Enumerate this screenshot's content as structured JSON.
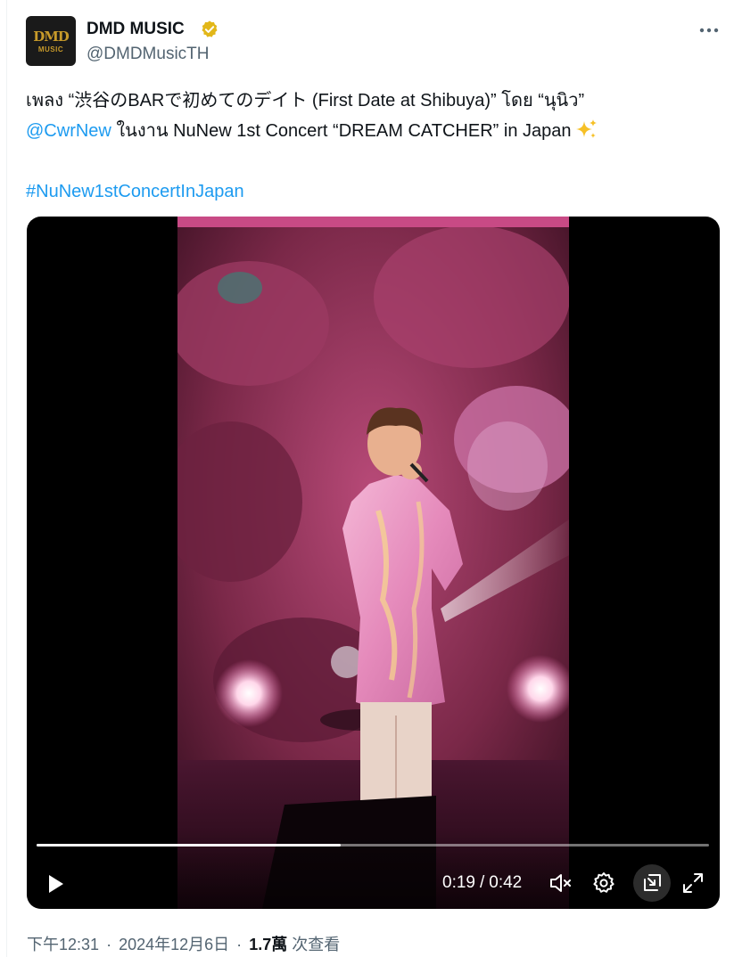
{
  "author": {
    "display_name": "DMD MUSIC",
    "handle": "@DMDMusicTH",
    "avatar_text_top": "DMD",
    "avatar_text_bottom": "MUSIC",
    "verified_color": "#e2b719"
  },
  "tweet": {
    "line1": "เพลง “渋谷のBARで初めてのデイト (First Date at Shibuya)” โดย “นุนิว”",
    "mention": "@CwrNew",
    "line2_rest": " ในงาน NuNew 1st Concert “DREAM CATCHER” in Japan",
    "sparkle_icon": "sparkles-icon",
    "hashtag": "#NuNew1stConcertInJapan"
  },
  "video": {
    "current_time": "0:19",
    "time_separator": "/",
    "duration": "0:42",
    "progress": 0.452
  },
  "meta": {
    "time": "下午12:31",
    "date": "2024年12月6日",
    "separator": "·",
    "views_count": "1.7萬",
    "views_label": "次查看"
  },
  "colors": {
    "link": "#1d9bf0",
    "text": "#0f1419",
    "secondary": "#536471",
    "stage_pink": "#d9628f"
  }
}
